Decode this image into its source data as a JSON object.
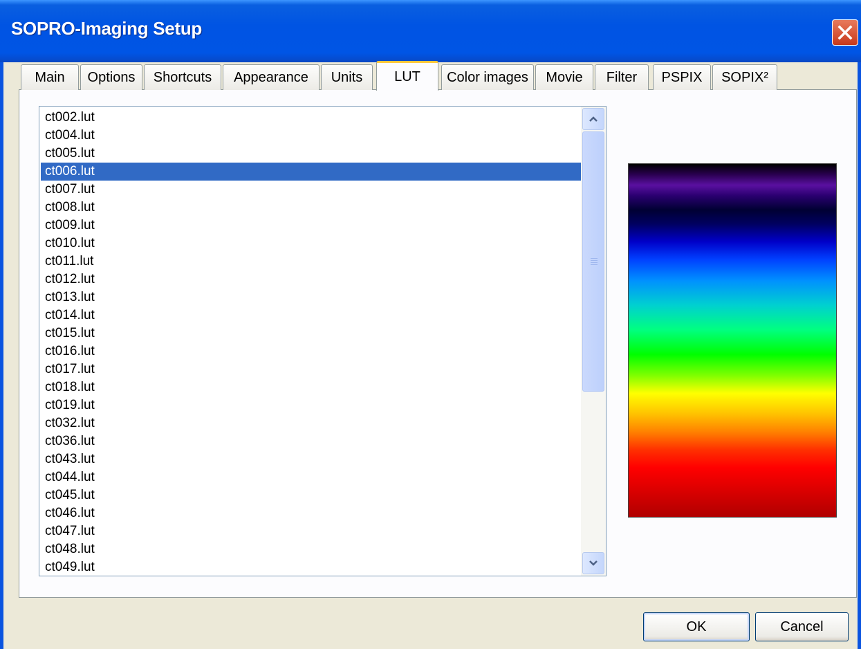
{
  "window": {
    "title": "SOPRO-Imaging Setup"
  },
  "tabs": [
    {
      "label": "Main",
      "active": false
    },
    {
      "label": "Options",
      "active": false
    },
    {
      "label": "Shortcuts",
      "active": false
    },
    {
      "label": "Appearance",
      "active": false
    },
    {
      "label": "Units",
      "active": false
    },
    {
      "label": "LUT",
      "active": true
    },
    {
      "label": "Color images",
      "active": false
    },
    {
      "label": "Movie",
      "active": false
    },
    {
      "label": "Filter",
      "active": false
    },
    {
      "label": "PSPIX",
      "active": false
    },
    {
      "label": "SOPIX²",
      "active": false
    }
  ],
  "lut_list": {
    "items": [
      "ct002.lut",
      "ct004.lut",
      "ct005.lut",
      "ct006.lut",
      "ct007.lut",
      "ct008.lut",
      "ct009.lut",
      "ct010.lut",
      "ct011.lut",
      "ct012.lut",
      "ct013.lut",
      "ct014.lut",
      "ct015.lut",
      "ct016.lut",
      "ct017.lut",
      "ct018.lut",
      "ct019.lut",
      "ct032.lut",
      "ct036.lut",
      "ct043.lut",
      "ct044.lut",
      "ct045.lut",
      "ct046.lut",
      "ct047.lut",
      "ct048.lut",
      "ct049.lut"
    ],
    "selected": "ct006.lut"
  },
  "buttons": {
    "ok": "OK",
    "cancel": "Cancel"
  },
  "colors": {
    "titlebar": "#0054e3",
    "selection": "#316ac5",
    "active_tab_accent": "#ffc83c"
  }
}
